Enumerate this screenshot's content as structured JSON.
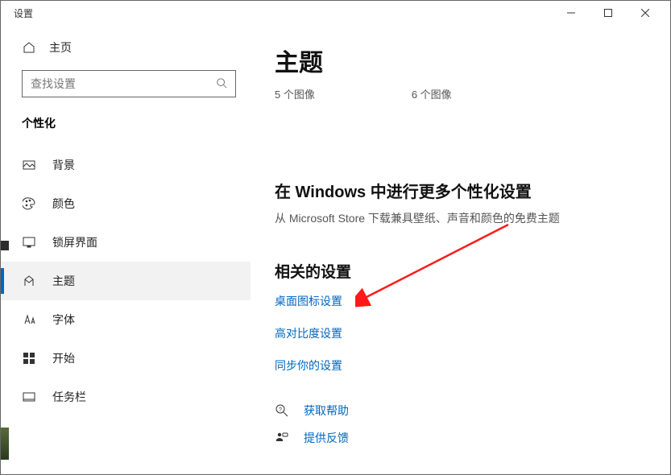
{
  "window": {
    "title": "设置"
  },
  "sidebar": {
    "home_label": "主页",
    "search_placeholder": "查找设置",
    "category": "个性化",
    "items": [
      {
        "label": "背景",
        "icon": "picture"
      },
      {
        "label": "颜色",
        "icon": "palette"
      },
      {
        "label": "锁屏界面",
        "icon": "lock-screen"
      },
      {
        "label": "主题",
        "icon": "theme",
        "selected": true
      },
      {
        "label": "字体",
        "icon": "font"
      },
      {
        "label": "开始",
        "icon": "start"
      },
      {
        "label": "任务栏",
        "icon": "taskbar"
      }
    ]
  },
  "main": {
    "title": "主题",
    "thumb_captions": [
      "5 个图像",
      "6 个图像"
    ],
    "more_heading": "在 Windows 中进行更多个性化设置",
    "more_sub": "从 Microsoft Store 下载兼具壁纸、声音和颜色的免费主题",
    "related_heading": "相关的设置",
    "related_links": [
      "桌面图标设置",
      "高对比度设置",
      "同步你的设置"
    ],
    "help_links": [
      "获取帮助",
      "提供反馈"
    ]
  }
}
